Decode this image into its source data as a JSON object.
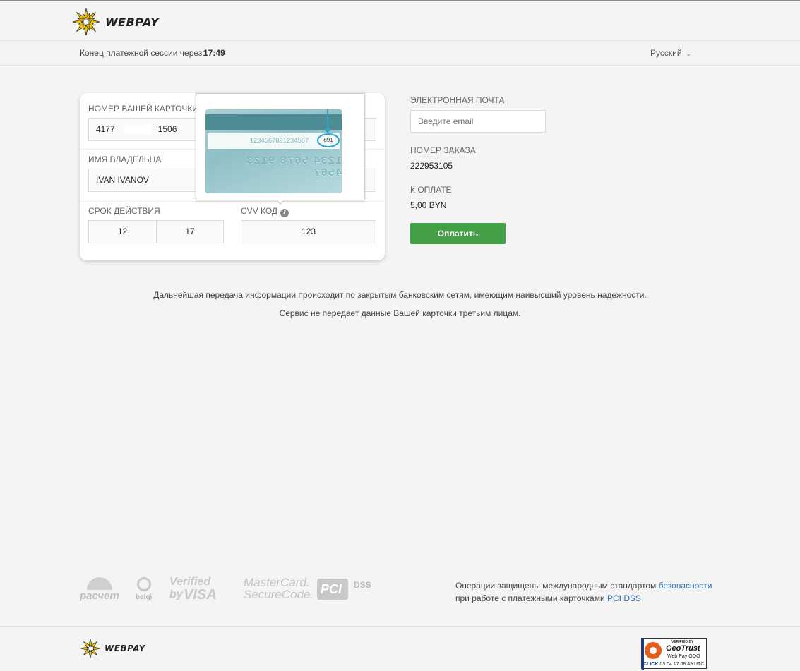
{
  "header": {
    "brand": "WEBPAY",
    "session_label": "Конец платежной сессии через:",
    "session_time": "17:49",
    "language": "Русский"
  },
  "card_form": {
    "card_number_label": "НОМЕР ВАШЕЙ КАРТОЧКИ",
    "card_number_prefix": "4177",
    "card_number_suffix": "'1506",
    "holder_label": "ИМЯ ВЛАДЕЛЬЦА",
    "holder_value": "IVAN IVANOV",
    "expiry_label": "СРОК ДЕЙСТВИЯ",
    "expiry_month": "12",
    "expiry_year": "17",
    "cvv_label": "CVV КОД",
    "cvv_value": "123"
  },
  "cvv_tooltip": {
    "signature_digits": "1234567891234567",
    "cvv_sample": "891",
    "embossed_number": "1234 5678 9123 4567"
  },
  "order": {
    "email_label": "ЭЛЕКТРОННАЯ ПОЧТА",
    "email_placeholder": "Введите email",
    "order_number_label": "НОМЕР ЗАКАЗА",
    "order_number": "222953105",
    "amount_label": "К ОПЛАТЕ",
    "amount": "5,00 BYN",
    "pay_button": "Оплатить"
  },
  "notices": {
    "line1": "Дальнейшая передача информации происходит по закрытым банковским сетям, имеющим наивысший уровень надежности.",
    "line2": "Сервис не передает данные Вашей карточки третьим лицам."
  },
  "partner_logos": {
    "raschet": "расчет",
    "belqi": "belqi",
    "visa_line1": "Verified by",
    "visa_line2": "VISA",
    "mc_line1": "MasterCard.",
    "mc_line2": "SecureCode.",
    "pci": "PCI",
    "dss": "DSS"
  },
  "security": {
    "text1": "Операции защищены международным стандартом ",
    "link1": "безопасности",
    "text2": "при работе с платежными карточками ",
    "link2": "PCI DSS"
  },
  "footer": {
    "brand": "WEBPAY",
    "geotrust": {
      "verified": "VERIFIED BY",
      "name": "GeoTrust",
      "company": "Web Pay OOO",
      "click": "CLICK",
      "date": "03.04.17 08:49 UTC"
    }
  },
  "colors": {
    "accent_green": "#43a047",
    "link_blue": "#2f6db5",
    "logo_yellow": "#f5c400"
  }
}
